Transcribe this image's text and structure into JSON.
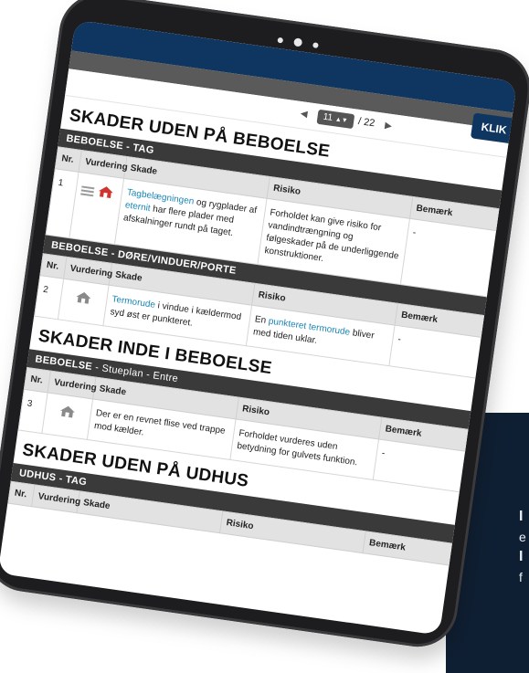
{
  "page": {
    "klik_label": "KLIK",
    "pager": {
      "current": "11",
      "total": "/ 22"
    }
  },
  "sections": [
    {
      "title": "SKADER UDEN PÅ BEBOELSE",
      "categories": [
        {
          "name": "BEBOELSE - TAG",
          "sub": "",
          "headers": {
            "nr": "Nr.",
            "vurdering": "Vurdering",
            "skade": "Skade",
            "risiko": "Risiko",
            "bemaerkning": "Bemærk"
          },
          "rows": [
            {
              "nr": "1",
              "rating": "red",
              "skade": {
                "pre": "",
                "link1": "Tagbelægningen",
                "mid": " og rygplader af ",
                "link2": "eternit",
                "post": " har flere plader med afskalninger rundt på taget."
              },
              "risiko": {
                "pre": "Forholdet kan give risiko for vandindtrængning og følgeskader på de underliggende konstruktioner.",
                "link": "",
                "post": ""
              },
              "bemaerkning": "-"
            }
          ]
        },
        {
          "name": "BEBOELSE - DØRE/VINDUER/PORTE",
          "sub": "",
          "headers": {
            "nr": "Nr.",
            "vurdering": "Vurdering",
            "skade": "Skade",
            "risiko": "Risiko",
            "bemaerkning": "Bemærk"
          },
          "rows": [
            {
              "nr": "2",
              "rating": "grey",
              "skade": {
                "pre": "",
                "link1": "Termorude",
                "mid": " i vindue i kældermod syd øst  er punkteret.",
                "link2": "",
                "post": ""
              },
              "risiko": {
                "pre": "En ",
                "link": "punkteret termorude",
                "post": " bliver med tiden uklar."
              },
              "bemaerkning": "-"
            }
          ]
        }
      ]
    },
    {
      "title": "SKADER INDE I BEBOELSE",
      "categories": [
        {
          "name": "BEBOELSE",
          "sub": " - Stueplan - Entre",
          "headers": {
            "nr": "Nr.",
            "vurdering": "Vurdering",
            "skade": "Skade",
            "risiko": "Risiko",
            "bemaerkning": "Bemærk"
          },
          "rows": [
            {
              "nr": "3",
              "rating": "grey",
              "skade": {
                "pre": "Der er en revnet flise ved trappe mod kælder.",
                "link1": "",
                "mid": "",
                "link2": "",
                "post": ""
              },
              "risiko": {
                "pre": "Forholdet vurderes uden betydning for gulvets funktion.",
                "link": "",
                "post": ""
              },
              "bemaerkning": "-"
            }
          ]
        }
      ]
    },
    {
      "title": "SKADER UDEN PÅ UDHUS",
      "categories": [
        {
          "name": "UDHUS - TAG",
          "sub": "",
          "headers": {
            "nr": "Nr.",
            "vurdering": "Vurdering",
            "skade": "Skade",
            "risiko": "Risiko",
            "bemaerkning": "Bemærk"
          },
          "rows": []
        }
      ]
    }
  ],
  "background": {
    "colors": {
      "panel": "#0f1f33",
      "screen_topbar": "#0e3660",
      "category_bar": "#3a3a3a",
      "link": "#1b86b8"
    },
    "fragments": [
      "I",
      "e",
      "I",
      "f"
    ]
  }
}
